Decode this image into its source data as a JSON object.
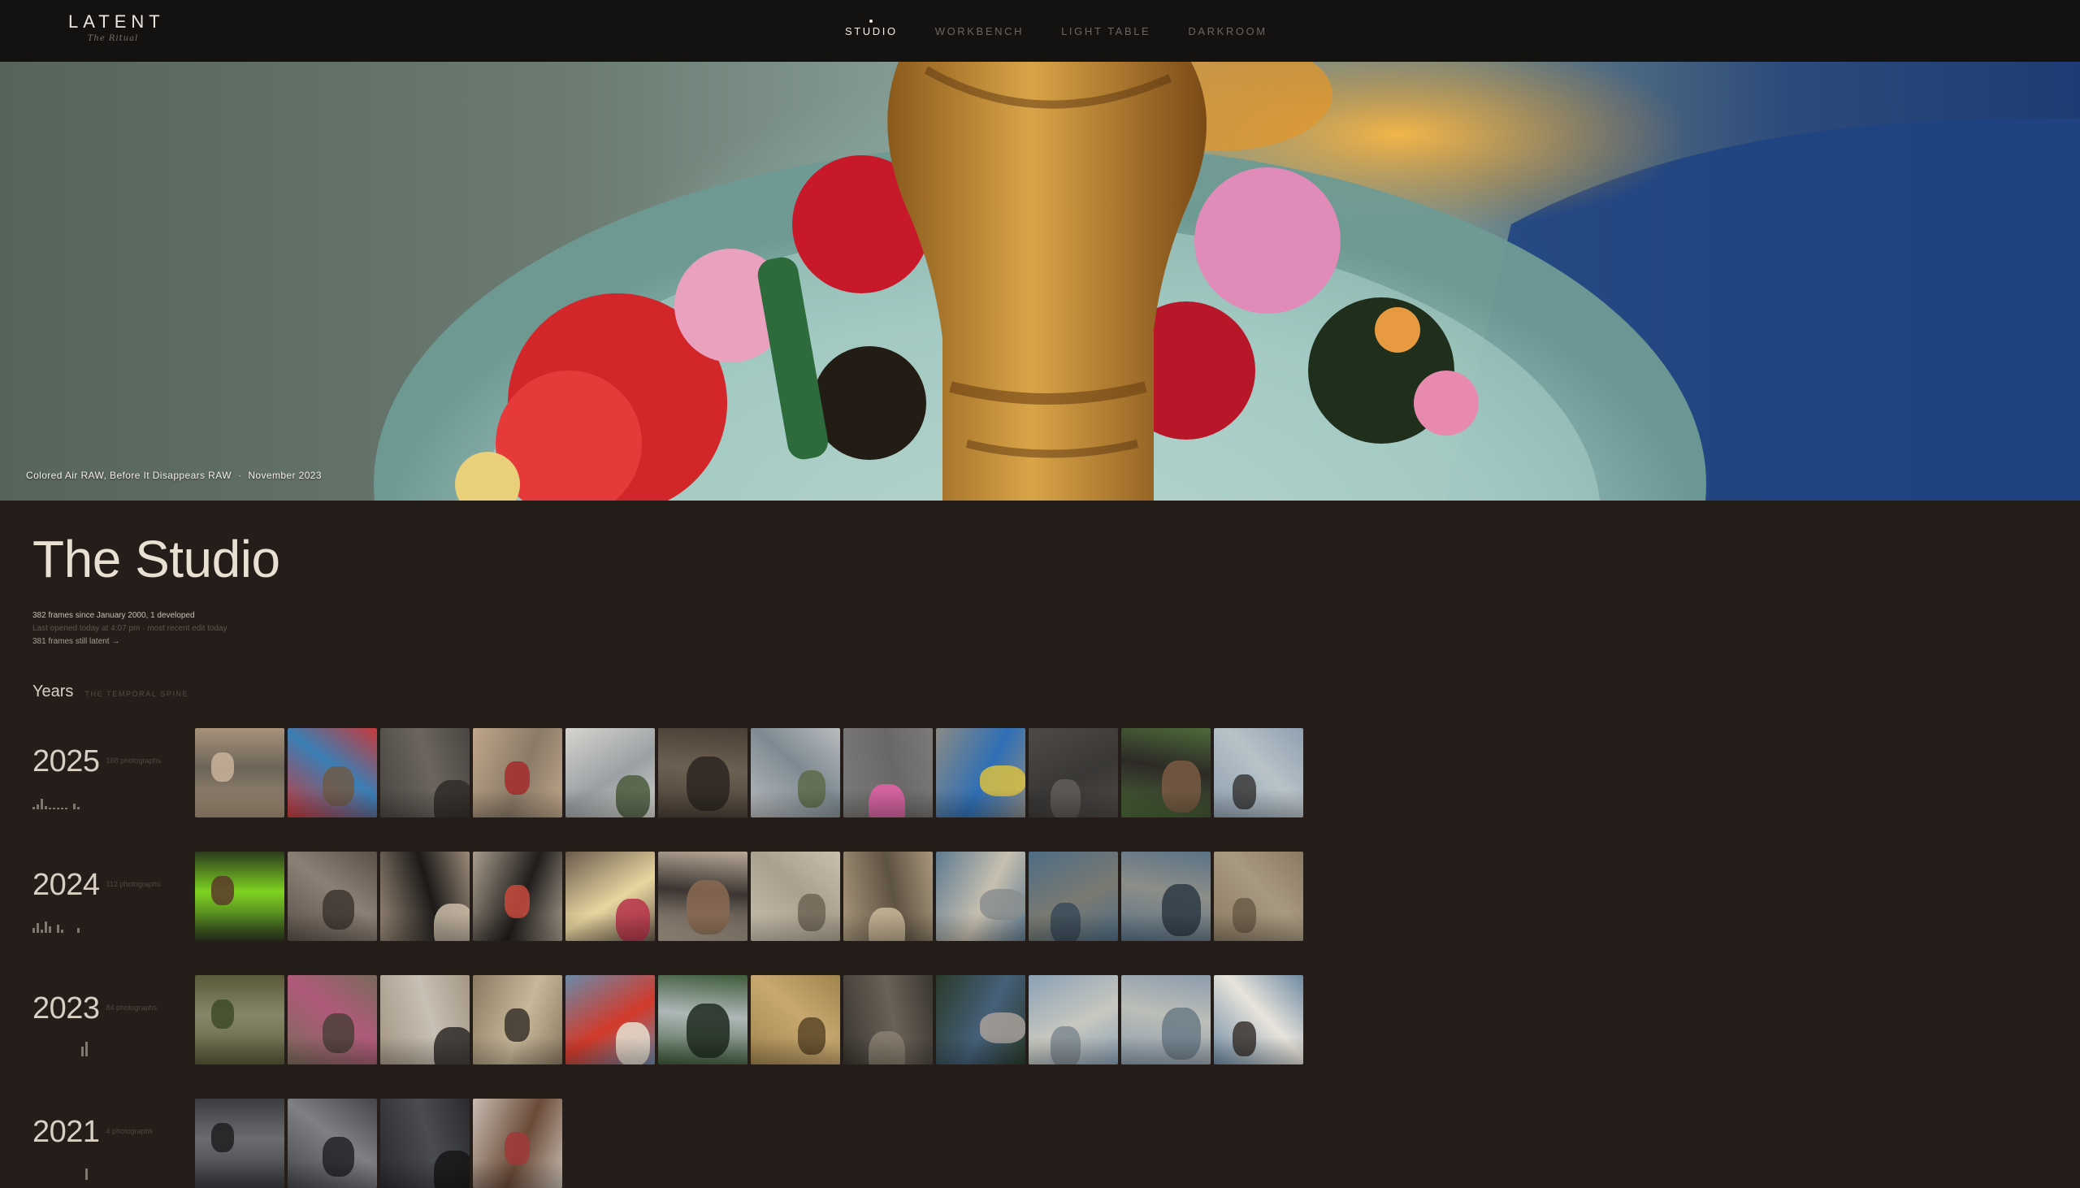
{
  "brand": {
    "title": "LATENT",
    "subtitle": "The Ritual"
  },
  "nav": [
    {
      "label": "STUDIO",
      "active": true
    },
    {
      "label": "WORKBENCH",
      "active": false
    },
    {
      "label": "LIGHT TABLE",
      "active": false
    },
    {
      "label": "DARKROOM",
      "active": false
    }
  ],
  "hero": {
    "caption": "Colored Air RAW, Before It Disappears RAW",
    "separator": "·",
    "date": "November 2023"
  },
  "studio": {
    "title": "The Studio",
    "stats_line1": "382 frames since January 2000, 1 developed",
    "stats_line2": "Last opened today at 4:07 pm  ·  most recent edit today",
    "stats_line3": "381 frames still latent →"
  },
  "years_section": {
    "title": "Years",
    "subtitle": "THE TEMPORAL SPINE"
  },
  "years": [
    {
      "year": "2025",
      "count": "188 photographs",
      "spark": [
        3,
        6,
        13,
        4,
        2,
        2,
        2,
        2,
        2,
        0,
        7,
        3
      ],
      "thumbs": [
        {
          "a": "#a8927a",
          "b": "#6c6458",
          "c": "#c9b39a"
        },
        {
          "a": "#c63a3a",
          "b": "#3a7fb5",
          "c": "#6e5a48"
        },
        {
          "a": "#4a4541",
          "b": "#6b655e",
          "c": "#2f2b28"
        },
        {
          "a": "#bfa68a",
          "b": "#8a7a68",
          "c": "#a52c2c"
        },
        {
          "a": "#d6d4cf",
          "b": "#9aa0a3",
          "c": "#4b5c3d"
        },
        {
          "a": "#4a3f35",
          "b": "#6c6052",
          "c": "#2c2621"
        },
        {
          "a": "#b9bcbf",
          "b": "#7e8a92",
          "c": "#5e6b4a"
        },
        {
          "a": "#7c7a78",
          "b": "#6a6866",
          "c": "#e462a8"
        },
        {
          "a": "#8a8a86",
          "b": "#2f6fb5",
          "c": "#d9c042"
        },
        {
          "a": "#4d4a47",
          "b": "#3a3836",
          "c": "#625e5a"
        },
        {
          "a": "#4c6a3a",
          "b": "#2d2a26",
          "c": "#7a5a44"
        },
        {
          "a": "#8fa0b0",
          "b": "#b8c2c8",
          "c": "#3a3a3a"
        }
      ]
    },
    {
      "year": "2024",
      "count": "112 photographs",
      "spark": [
        6,
        12,
        4,
        14,
        8,
        0,
        10,
        4,
        0,
        0,
        0,
        6
      ],
      "thumbs": [
        {
          "a": "#2c3a1e",
          "b": "#7ed321",
          "c": "#5b3a2a"
        },
        {
          "a": "#5a5048",
          "b": "#8c8076",
          "c": "#3d352f"
        },
        {
          "a": "#9a8a78",
          "b": "#1c1a19",
          "c": "#cbbca8"
        },
        {
          "a": "#a89c8c",
          "b": "#201d1c",
          "c": "#c84a3c"
        },
        {
          "a": "#6a5a4c",
          "b": "#e8d6a0",
          "c": "#b8324a"
        },
        {
          "a": "#b8aa98",
          "b": "#3b3431",
          "c": "#8a6a52"
        },
        {
          "a": "#c8bfae",
          "b": "#aaa08e",
          "c": "#6e6556"
        },
        {
          "a": "#a8977c",
          "b": "#5e5242",
          "c": "#cbb99a"
        },
        {
          "a": "#5e7a90",
          "b": "#c7c0b0",
          "c": "#8a8e8e"
        },
        {
          "a": "#4e6c84",
          "b": "#7a7a72",
          "c": "#3a4a58"
        },
        {
          "a": "#5a7286",
          "b": "#8d8e88",
          "c": "#2d3a44"
        },
        {
          "a": "#8a7a62",
          "b": "#a89a80",
          "c": "#6a5c48"
        }
      ]
    },
    {
      "year": "2023",
      "count": "84 photographs",
      "spark": [
        0,
        0,
        0,
        0,
        0,
        0,
        0,
        0,
        0,
        0,
        0,
        0,
        12,
        18
      ],
      "thumbs": [
        {
          "a": "#5a5a3a",
          "b": "#86866a",
          "c": "#3d4a2a"
        },
        {
          "a": "#7a6a5a",
          "b": "#b05a7a",
          "c": "#4b4038"
        },
        {
          "a": "#a49684",
          "b": "#c8c0b4",
          "c": "#2e2a28"
        },
        {
          "a": "#8a7a62",
          "b": "#c8b89a",
          "c": "#3a332c"
        },
        {
          "a": "#6a8aa8",
          "b": "#d23a2a",
          "c": "#e8e0d0"
        },
        {
          "a": "#3e5a3a",
          "b": "#aeb8b8",
          "c": "#1f2a1e"
        },
        {
          "a": "#a0844e",
          "b": "#c8a870",
          "c": "#5a4628"
        },
        {
          "a": "#3a3630",
          "b": "#6a6258",
          "c": "#8a8070"
        },
        {
          "a": "#2a3a2a",
          "b": "#46607a",
          "c": "#a8a09a"
        },
        {
          "a": "#8aa0b4",
          "b": "#c8c8c0",
          "c": "#7e8a90"
        },
        {
          "a": "#8c9cac",
          "b": "#bcbeb8",
          "c": "#6a7a86"
        },
        {
          "a": "#6e8aa2",
          "b": "#e8e4dc",
          "c": "#3a3430"
        }
      ]
    },
    {
      "year": "2021",
      "count": "4 photographs",
      "spark": [
        0,
        0,
        0,
        0,
        0,
        0,
        0,
        0,
        0,
        0,
        0,
        0,
        0,
        14
      ],
      "thumbs": [
        {
          "a": "#3a3c40",
          "b": "#6a6c70",
          "c": "#1d1e20"
        },
        {
          "a": "#44464a",
          "b": "#7e8084",
          "c": "#222326"
        },
        {
          "a": "#2a2b2e",
          "b": "#4a4c50",
          "c": "#161618"
        },
        {
          "a": "#c8bcb0",
          "b": "#6a4a38",
          "c": "#a03a3a"
        }
      ]
    }
  ]
}
